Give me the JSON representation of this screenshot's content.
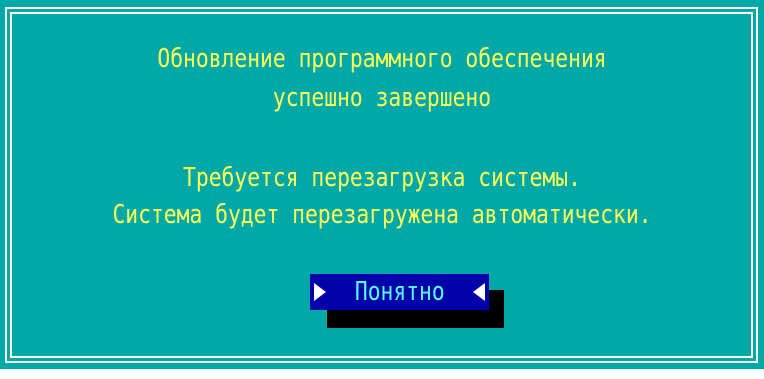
{
  "dialog": {
    "title_line1": "Обновление программного обеспечения",
    "title_line2": "успешно завершено",
    "message_line1": "Требуется перезагрузка системы.",
    "message_line2": "Система будет перезагружена автоматически.",
    "ok_button_label": "Понятно",
    "colors": {
      "background": "#00a8a8",
      "text": "#ffff55",
      "button_bg": "#0000aa",
      "button_text": "#55ffff",
      "frame": "#ffffff"
    }
  }
}
